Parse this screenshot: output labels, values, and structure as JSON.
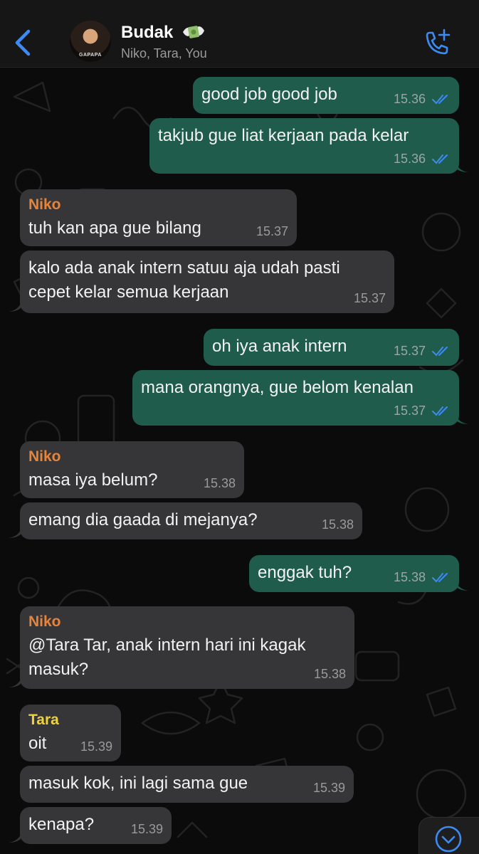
{
  "header": {
    "group_name": "Budak",
    "members": "Niko, Tara, You",
    "avatar_caption": "GAPAPA"
  },
  "colors": {
    "accent": "#3d8bf2",
    "outgoing_bubble": "#1f5c4b",
    "incoming_bubble": "#363638",
    "niko": "#e8843a",
    "tara": "#f0d23a"
  },
  "messages": [
    {
      "dir": "out",
      "text": "good job good job",
      "time": "15.36"
    },
    {
      "dir": "out",
      "text": "takjub gue liat kerjaan pada kelar",
      "time": "15.36"
    },
    {
      "dir": "in",
      "sender": "Niko",
      "text": "tuh kan apa gue bilang",
      "time": "15.37"
    },
    {
      "dir": "in",
      "text_line1": "kalo ada anak intern satuu aja udah pasti",
      "text_line2": "cepet kelar semua kerjaan",
      "time": "15.37"
    },
    {
      "dir": "out",
      "text": "oh iya anak intern",
      "time": "15.37"
    },
    {
      "dir": "out",
      "text": "mana orangnya, gue belom kenalan",
      "time": "15.37"
    },
    {
      "dir": "in",
      "sender": "Niko",
      "text": "masa iya belum?",
      "time": "15.38"
    },
    {
      "dir": "in",
      "text": "emang dia gaada di mejanya?",
      "time": "15.38"
    },
    {
      "dir": "out",
      "text": "enggak tuh?",
      "time": "15.38"
    },
    {
      "dir": "in",
      "sender": "Niko",
      "text_line1": "@Tara Tar, anak intern hari ini kagak",
      "text_line2": "masuk?",
      "time": "15.38"
    },
    {
      "dir": "in",
      "sender": "Tara",
      "text": "oit",
      "time": "15.39"
    },
    {
      "dir": "in",
      "text": "masuk kok, ini lagi sama gue",
      "time": "15.39"
    },
    {
      "dir": "in",
      "text": "kenapa?",
      "time": "15.39"
    }
  ]
}
